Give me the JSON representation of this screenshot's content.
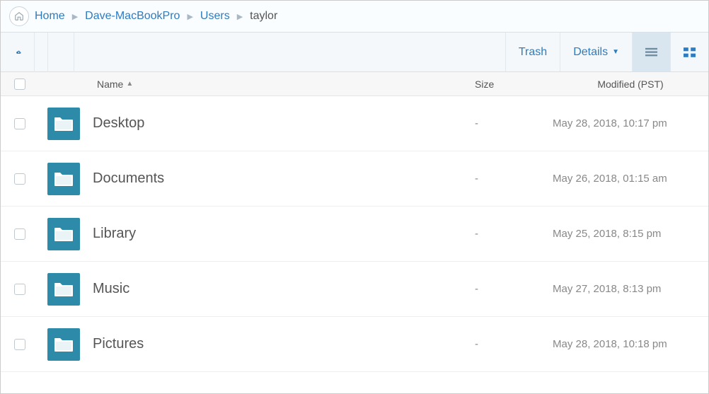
{
  "breadcrumb": {
    "items": [
      {
        "label": "Home"
      },
      {
        "label": "Dave-MacBookPro"
      },
      {
        "label": "Users"
      },
      {
        "label": "taylor"
      }
    ]
  },
  "toolbar": {
    "trash_label": "Trash",
    "details_label": "Details"
  },
  "columns": {
    "name": "Name",
    "size": "Size",
    "modified": "Modified (PST)"
  },
  "rows": [
    {
      "name": "Desktop",
      "size": "-",
      "modified": "May 28, 2018, 10:17 pm"
    },
    {
      "name": "Documents",
      "size": "-",
      "modified": "May 26, 2018, 01:15 am"
    },
    {
      "name": "Library",
      "size": "-",
      "modified": "May 25, 2018, 8:15 pm"
    },
    {
      "name": "Music",
      "size": "-",
      "modified": "May 27, 2018, 8:13 pm"
    },
    {
      "name": "Pictures",
      "size": "-",
      "modified": "May 28, 2018, 10:18 pm"
    }
  ]
}
